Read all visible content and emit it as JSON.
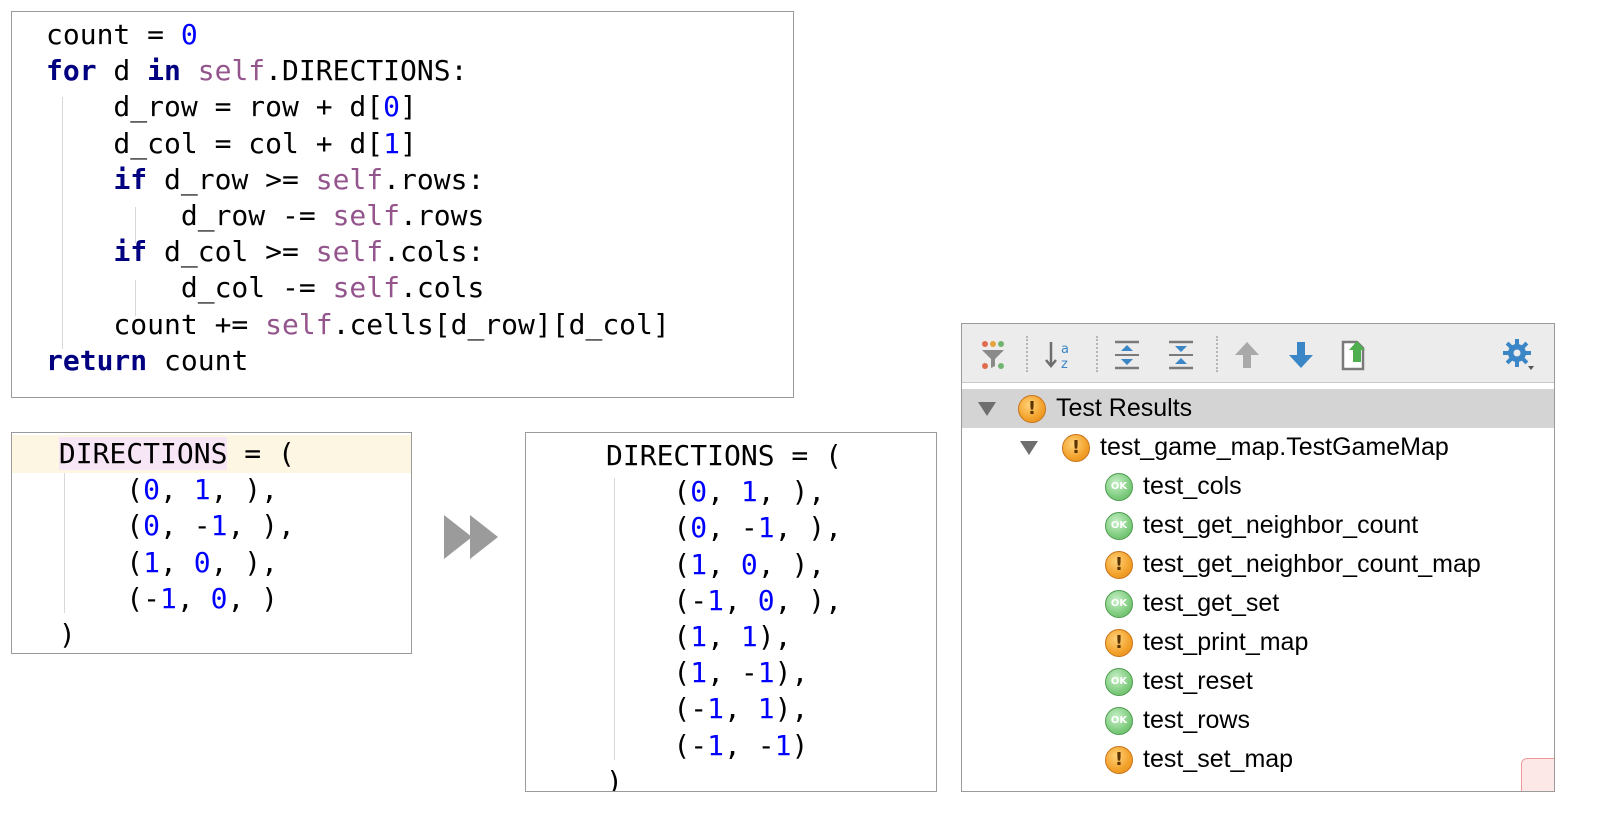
{
  "code_main": [
    [
      {
        "t": "count = "
      },
      {
        "t": "0",
        "c": "num"
      }
    ],
    [
      {
        "t": "for",
        "c": "kw"
      },
      {
        "t": " d "
      },
      {
        "t": "in",
        "c": "kw"
      },
      {
        "t": " "
      },
      {
        "t": "self",
        "c": "slf"
      },
      {
        "t": ".DIRECTIONS:"
      }
    ],
    [
      {
        "t": "    d_row = row + d["
      },
      {
        "t": "0",
        "c": "num"
      },
      {
        "t": "]"
      }
    ],
    [
      {
        "t": "    d_col = col + d["
      },
      {
        "t": "1",
        "c": "num"
      },
      {
        "t": "]"
      }
    ],
    [
      {
        "t": "    "
      },
      {
        "t": "if",
        "c": "kw"
      },
      {
        "t": " d_row >= "
      },
      {
        "t": "self",
        "c": "slf"
      },
      {
        "t": ".rows:"
      }
    ],
    [
      {
        "t": "        d_row -= "
      },
      {
        "t": "self",
        "c": "slf"
      },
      {
        "t": ".rows"
      }
    ],
    [
      {
        "t": "    "
      },
      {
        "t": "if",
        "c": "kw"
      },
      {
        "t": " d_col >= "
      },
      {
        "t": "self",
        "c": "slf"
      },
      {
        "t": ".cols:"
      }
    ],
    [
      {
        "t": "        d_col -= "
      },
      {
        "t": "self",
        "c": "slf"
      },
      {
        "t": ".cols"
      }
    ],
    [
      {
        "t": "    count += "
      },
      {
        "t": "self",
        "c": "slf"
      },
      {
        "t": ".cells[d_row][d_col]"
      }
    ],
    [
      {
        "t": "return",
        "c": "kw"
      },
      {
        "t": " count"
      }
    ]
  ],
  "code_before": [
    [
      {
        "t": " "
      },
      {
        "t": "DIRECTIONS",
        "c": "hlword"
      },
      {
        "t": " = ("
      }
    ],
    [
      {
        "t": "     ("
      },
      {
        "t": "0",
        "c": "num"
      },
      {
        "t": ", "
      },
      {
        "t": "1",
        "c": "num"
      },
      {
        "t": ", ),"
      }
    ],
    [
      {
        "t": "     ("
      },
      {
        "t": "0",
        "c": "num"
      },
      {
        "t": ", -"
      },
      {
        "t": "1",
        "c": "num"
      },
      {
        "t": ", ),"
      }
    ],
    [
      {
        "t": "     ("
      },
      {
        "t": "1",
        "c": "num"
      },
      {
        "t": ", "
      },
      {
        "t": "0",
        "c": "num"
      },
      {
        "t": ", ),"
      }
    ],
    [
      {
        "t": "     (-"
      },
      {
        "t": "1",
        "c": "num"
      },
      {
        "t": ", "
      },
      {
        "t": "0",
        "c": "num"
      },
      {
        "t": ", )"
      }
    ],
    [
      {
        "t": " )"
      }
    ]
  ],
  "code_after": [
    [
      {
        "t": "DIRECTIONS = ("
      }
    ],
    [
      {
        "t": "    ("
      },
      {
        "t": "0",
        "c": "num"
      },
      {
        "t": ", "
      },
      {
        "t": "1",
        "c": "num"
      },
      {
        "t": ", ),"
      }
    ],
    [
      {
        "t": "    ("
      },
      {
        "t": "0",
        "c": "num"
      },
      {
        "t": ", -"
      },
      {
        "t": "1",
        "c": "num"
      },
      {
        "t": ", ),"
      }
    ],
    [
      {
        "t": "    ("
      },
      {
        "t": "1",
        "c": "num"
      },
      {
        "t": ", "
      },
      {
        "t": "0",
        "c": "num"
      },
      {
        "t": ", ),"
      }
    ],
    [
      {
        "t": "    (-"
      },
      {
        "t": "1",
        "c": "num"
      },
      {
        "t": ", "
      },
      {
        "t": "0",
        "c": "num"
      },
      {
        "t": ", ),"
      }
    ],
    [
      {
        "t": "    ("
      },
      {
        "t": "1",
        "c": "num"
      },
      {
        "t": ", "
      },
      {
        "t": "1",
        "c": "num"
      },
      {
        "t": "),"
      }
    ],
    [
      {
        "t": "    ("
      },
      {
        "t": "1",
        "c": "num"
      },
      {
        "t": ", -"
      },
      {
        "t": "1",
        "c": "num"
      },
      {
        "t": "),"
      }
    ],
    [
      {
        "t": "    (-"
      },
      {
        "t": "1",
        "c": "num"
      },
      {
        "t": ", "
      },
      {
        "t": "1",
        "c": "num"
      },
      {
        "t": "),"
      }
    ],
    [
      {
        "t": "    (-"
      },
      {
        "t": "1",
        "c": "num"
      },
      {
        "t": ", -"
      },
      {
        "t": "1",
        "c": "num"
      },
      {
        "t": ")"
      }
    ],
    [
      {
        "t": ")"
      }
    ]
  ],
  "test_results": {
    "toolbar_icons": [
      "filter-icon",
      "sort-alpha-icon",
      "expand-all-icon",
      "collapse-all-icon",
      "previous-failed-icon",
      "next-failed-icon",
      "export-icon",
      "settings-gear-icon"
    ],
    "root": {
      "label": "Test Results",
      "status": "warning"
    },
    "suite": {
      "label": "test_game_map.TestGameMap",
      "status": "warning"
    },
    "tests": [
      {
        "label": "test_cols",
        "status": "ok"
      },
      {
        "label": "test_get_neighbor_count",
        "status": "ok"
      },
      {
        "label": "test_get_neighbor_count_map",
        "status": "warning"
      },
      {
        "label": "test_get_set",
        "status": "ok"
      },
      {
        "label": "test_print_map",
        "status": "warning"
      },
      {
        "label": "test_reset",
        "status": "ok"
      },
      {
        "label": "test_rows",
        "status": "ok"
      },
      {
        "label": "test_set_map",
        "status": "warning"
      }
    ],
    "ok_badge": "OK",
    "warn_badge": "!"
  },
  "colors": {
    "keyword": "#000080",
    "self": "#94558d",
    "number": "#0000ff",
    "ok": "#7fcc7f",
    "warning": "#f2a12a"
  }
}
